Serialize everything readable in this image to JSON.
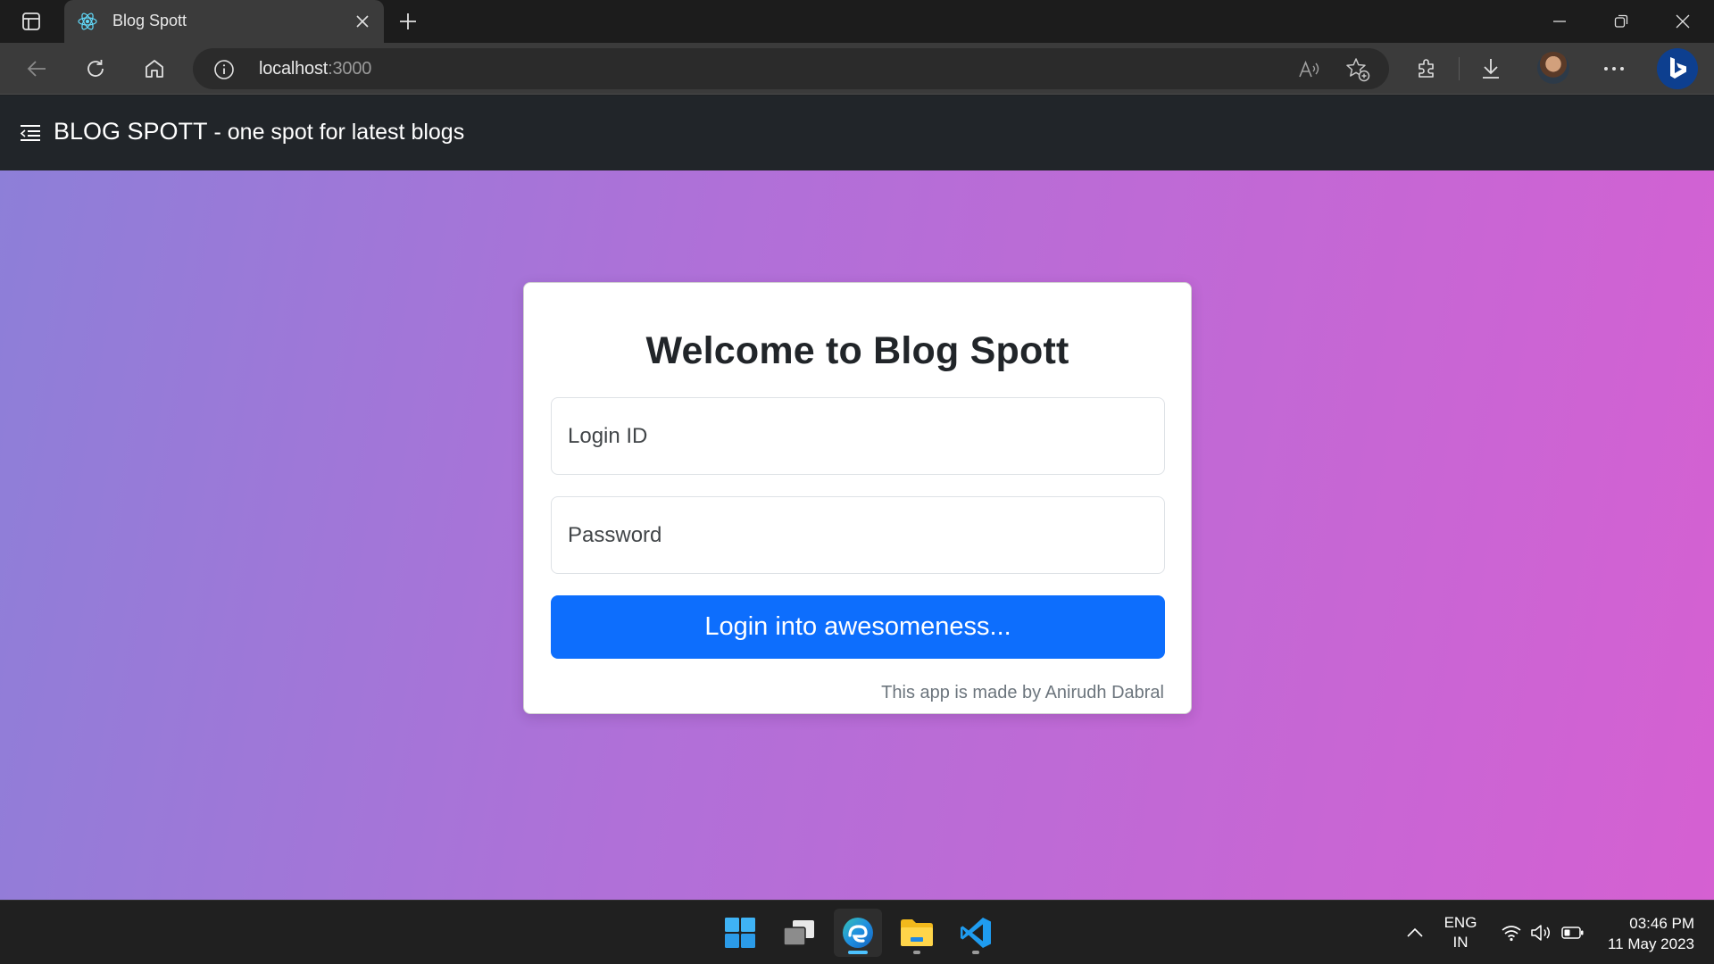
{
  "browser": {
    "tab": {
      "title": "Blog Spott"
    },
    "address": {
      "host": "localhost",
      "port": ":3000"
    }
  },
  "navbar": {
    "brand": "BLOG SPOTT",
    "tagline": " - one spot for latest blogs"
  },
  "login": {
    "title": "Welcome to Blog Spott",
    "login_id_placeholder": "Login ID",
    "password_placeholder": "Password",
    "submit_label": "Login into awesomeness...",
    "credit": "This app is made by Anirudh Dabral"
  },
  "taskbar": {
    "language_line1": "ENG",
    "language_line2": "IN",
    "time": "03:46 PM",
    "date": "11 May 2023"
  },
  "colors": {
    "navbar_bg": "#212529",
    "primary": "#0d6efd",
    "gradient_start": "#8d7fd8",
    "gradient_end": "#d560d2"
  },
  "icons": [
    "tab-actions-icon",
    "react-icon",
    "close-icon",
    "plus-icon",
    "minimize-icon",
    "restore-icon",
    "back-arrow-icon",
    "refresh-icon",
    "home-icon",
    "info-icon",
    "read-aloud-icon",
    "add-favorite-icon",
    "extensions-icon",
    "download-icon",
    "more-icon",
    "bing-icon",
    "menu-icon",
    "windows-start-icon",
    "task-view-icon",
    "edge-icon",
    "file-explorer-icon",
    "vscode-icon",
    "chevron-up-icon",
    "wifi-icon",
    "volume-icon",
    "battery-icon"
  ]
}
